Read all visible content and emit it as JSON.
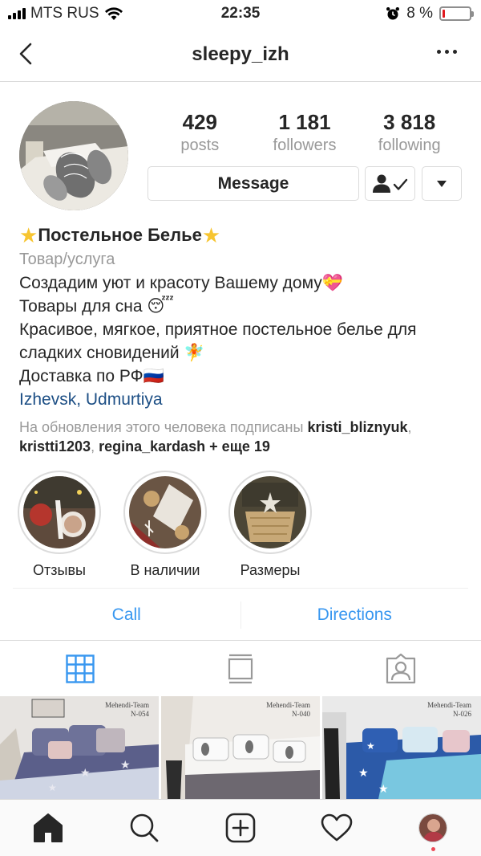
{
  "status_bar": {
    "carrier": "MTS RUS",
    "time": "22:35",
    "battery_percent_label": "8 %",
    "battery_level": 0.08,
    "battery_color": "#e0191e"
  },
  "nav": {
    "title": "sleepy_izh",
    "back_icon": "chevron-left-icon",
    "more_icon": "more-horizontal-icon"
  },
  "profile": {
    "stats": [
      {
        "value": "429",
        "label": "posts"
      },
      {
        "value": "1 181",
        "label": "followers"
      },
      {
        "value": "3 818",
        "label": "following"
      }
    ],
    "message_label": "Message",
    "following_icon": "user-check-icon",
    "dropdown_icon": "caret-down-icon"
  },
  "bio": {
    "name": "Постельное Белье",
    "category": "Товар/услуга",
    "lines": [
      "Создадим уют и красоту Вашему дому💝",
      "Товары для сна 😴",
      "Красивое, мягкое, приятное постельное белье для",
      "сладких сновидений 🧚",
      "Доставка по РФ🇷🇺"
    ],
    "location": "Izhevsk, Udmurtiya",
    "followed_by_prefix": "На обновления этого человека подписаны",
    "followed_by_users": [
      "kristi_bliznyuk",
      "kristti1203",
      "regina_kardash"
    ],
    "followed_by_more": "+ еще 19"
  },
  "highlights": [
    {
      "label": "Отзывы"
    },
    {
      "label": "В наличии"
    },
    {
      "label": "Размеры"
    }
  ],
  "actions": {
    "call": "Call",
    "directions": "Directions",
    "accent_color": "#3897f0"
  },
  "tabs": [
    {
      "icon": "grid-icon",
      "active": true
    },
    {
      "icon": "feed-list-icon",
      "active": false
    },
    {
      "icon": "tagged-icon",
      "active": false
    }
  ],
  "grid": [
    {
      "caption": [
        "Mehendi-Team",
        "N-054"
      ]
    },
    {
      "caption": [
        "Mehendi-Team",
        "N-040"
      ]
    },
    {
      "caption": [
        "Mehendi-Team",
        "N-026"
      ]
    }
  ],
  "bottom_bar": [
    {
      "icon": "home-icon"
    },
    {
      "icon": "search-icon"
    },
    {
      "icon": "add-post-icon"
    },
    {
      "icon": "heart-icon"
    },
    {
      "icon": "profile-avatar"
    }
  ]
}
